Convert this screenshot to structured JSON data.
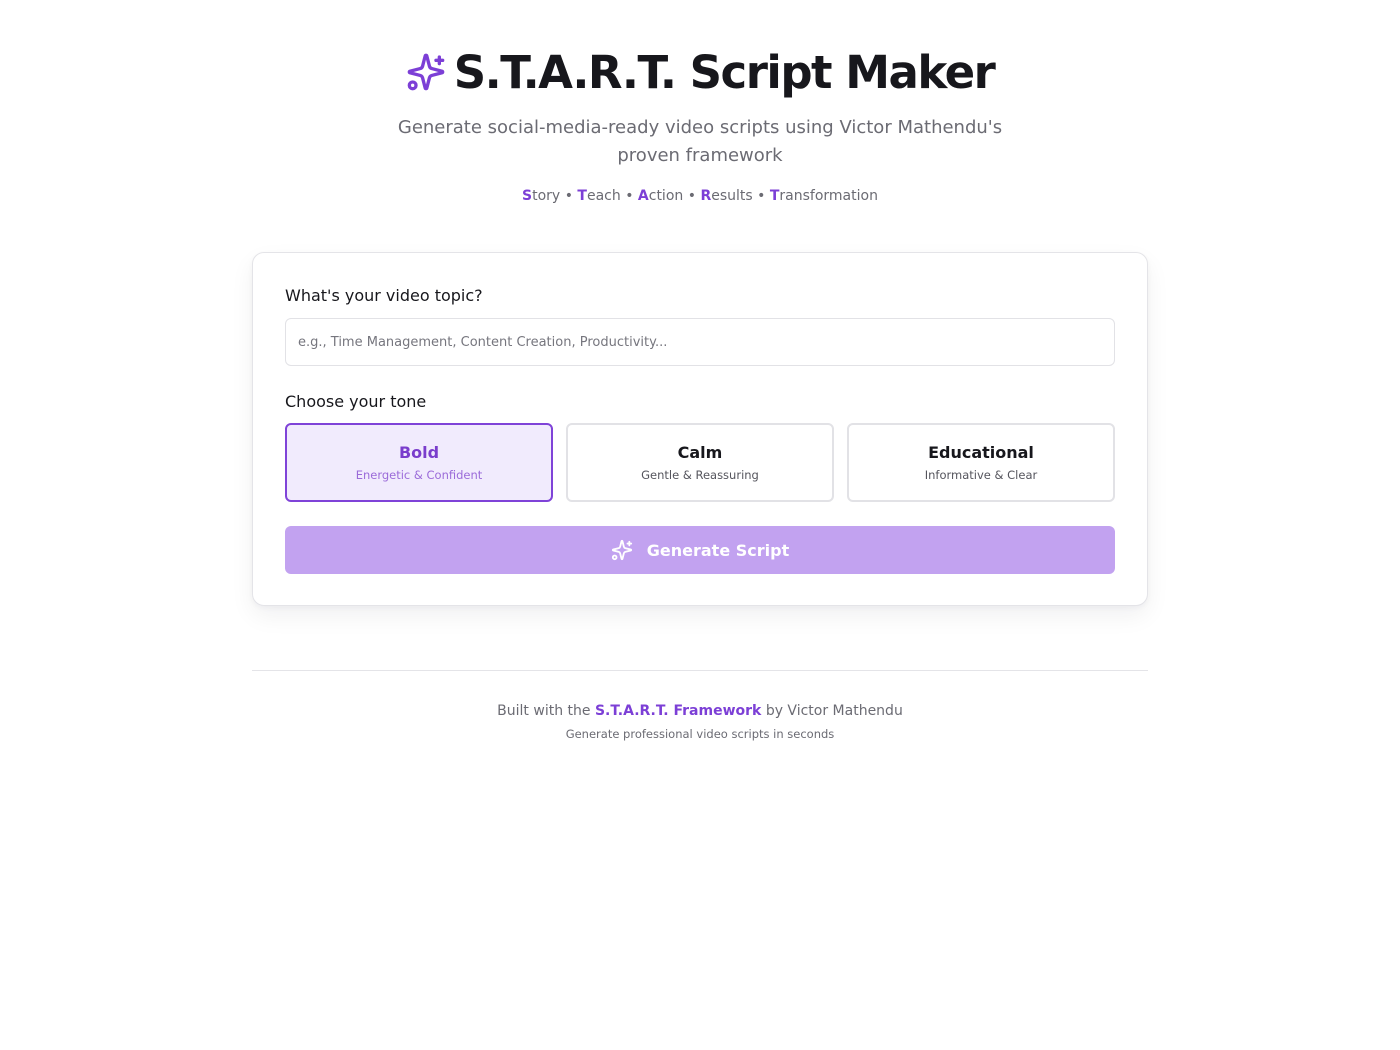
{
  "header": {
    "title": "S.T.A.R.T. Script Maker",
    "title_icon": "sparkles-icon",
    "subtitle": "Generate social-media-ready video scripts using Victor Mathendu's proven framework",
    "acronym": [
      {
        "letter": "S",
        "rest": "tory"
      },
      {
        "letter": "T",
        "rest": "each"
      },
      {
        "letter": "A",
        "rest": "ction"
      },
      {
        "letter": "R",
        "rest": "esults"
      },
      {
        "letter": "T",
        "rest": "ransformation"
      }
    ],
    "acronym_separator": "•"
  },
  "form": {
    "topic_label": "What's your video topic?",
    "topic_value": "",
    "topic_placeholder": "e.g., Time Management, Content Creation, Productivity...",
    "tone_label": "Choose your tone",
    "tones": [
      {
        "name": "Bold",
        "description": "Energetic & Confident",
        "selected": true
      },
      {
        "name": "Calm",
        "description": "Gentle & Reassuring",
        "selected": false
      },
      {
        "name": "Educational",
        "description": "Informative & Clear",
        "selected": false
      }
    ],
    "generate_label": "Generate Script",
    "generate_icon": "sparkles-icon"
  },
  "footer": {
    "prefix": "Built with the",
    "link_text": "S.T.A.R.T. Framework",
    "suffix": "by Victor Mathendu",
    "tagline": "Generate professional video scripts in seconds"
  },
  "colors": {
    "accent": "#7c3fd6",
    "selected_bg": "#f1ebfd",
    "button_disabled_bg": "#c2a2f0",
    "text": "#17171c",
    "muted": "#6b6b73"
  }
}
